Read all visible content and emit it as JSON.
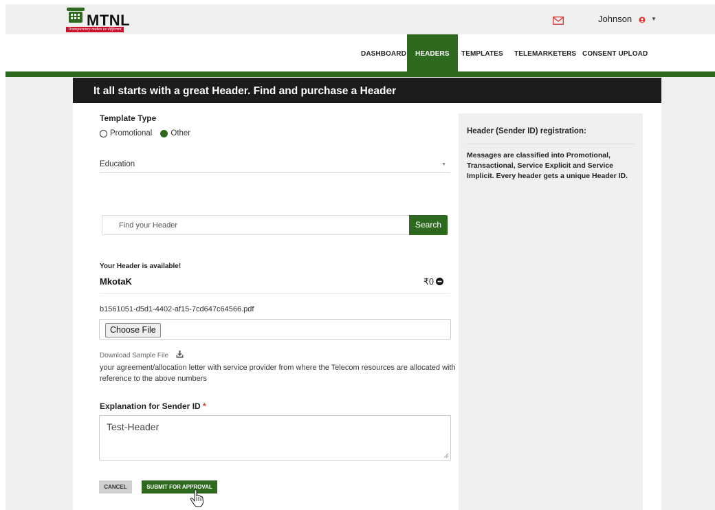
{
  "brand": {
    "name": "MTNL",
    "tagline": "Transparency makes us different"
  },
  "header": {
    "user_name": "Johnson",
    "icons": [
      "mail-icon",
      "user-icon",
      "caret-down-icon"
    ]
  },
  "nav": {
    "items": [
      {
        "label": "DASHBOARD",
        "active": false
      },
      {
        "label": "HEADERS",
        "active": true
      },
      {
        "label": "TEMPLATES",
        "active": false
      },
      {
        "label": "TELEMARKETERS",
        "active": false
      },
      {
        "label": "CONSENT UPLOAD",
        "active": false
      }
    ]
  },
  "banner": {
    "title": "It all starts with a great Header. Find and purchase a Header"
  },
  "form": {
    "template_type_label": "Template Type",
    "radio_promotional": "Promotional",
    "radio_other": "Other",
    "selected_radio": "Other",
    "category_value": "Education",
    "search_placeholder": "Find your Header",
    "search_button": "Search",
    "available_text": "Your Header is available!",
    "header_name": "MkotaK",
    "price": "₹0",
    "uploaded_filename": "b1561051-d5d1-4402-af15-7cd647c64566.pdf",
    "choose_file_label": "Choose File",
    "download_sample": "Download Sample File",
    "note": "your agreement/allocation letter with service provider from where the Telecom resources are allocated with reference to the above numbers",
    "explanation_label": "Explanation for Sender ID",
    "required_mark": "*",
    "explanation_value": "Test-Header",
    "cancel_label": "CANCEL",
    "submit_label": "SUBMIT FOR APPROVAL"
  },
  "panel": {
    "title": "Header (Sender ID) registration:",
    "text": "Messages are classified into Promotional, Transactional, Service Explicit and Service Implicit. Every header gets a unique Header ID."
  },
  "colors": {
    "brand_green": "#2d6a1f",
    "banner_bg": "#1c1c1c",
    "brand_red": "#c8102e"
  }
}
